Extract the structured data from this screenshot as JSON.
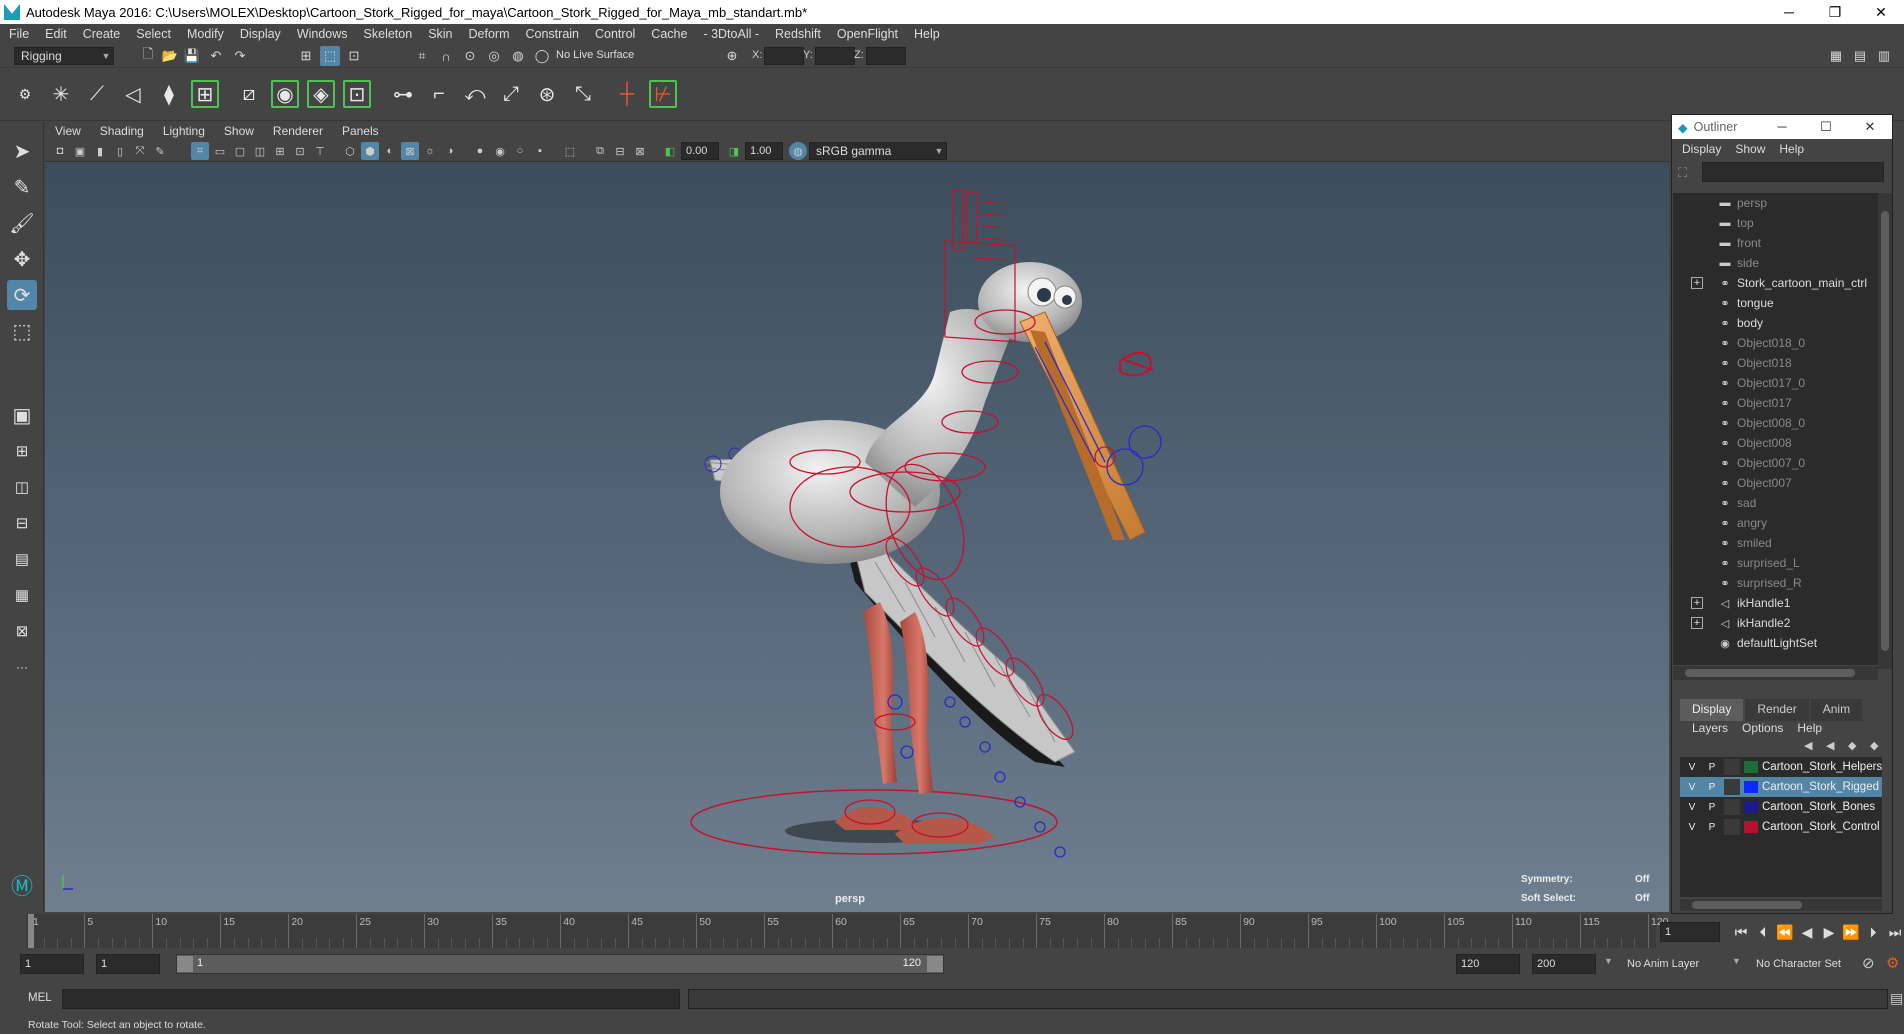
{
  "title_bar": {
    "title": "Autodesk Maya 2016: C:\\Users\\MOLEX\\Desktop\\Cartoon_Stork_Rigged_for_maya\\Cartoon_Stork_Rigged_for_Maya_mb_standart.mb*",
    "min": "─",
    "max": "❐",
    "close": "✕"
  },
  "menu": [
    "File",
    "Edit",
    "Create",
    "Select",
    "Modify",
    "Display",
    "Windows",
    "Skeleton",
    "Skin",
    "Deform",
    "Constrain",
    "Control",
    "Cache",
    "- 3DtoAll -",
    "Redshift",
    "OpenFlight",
    "Help"
  ],
  "status_line": {
    "menu_set": "Rigging",
    "live_surface": "No Live Surface",
    "x_label": "X:",
    "y_label": "Y:",
    "z_label": "Z:"
  },
  "viewport": {
    "menu": [
      "View",
      "Shading",
      "Lighting",
      "Show",
      "Renderer",
      "Panels"
    ],
    "near_value": "0.00",
    "far_value": "1.00",
    "color_space": "sRGB gamma",
    "camera_label": "persp",
    "hud": {
      "symmetry_label": "Symmetry:",
      "symmetry_value": "Off",
      "soft_select_label": "Soft Select:",
      "soft_select_value": "Off"
    },
    "colors": {
      "mesh": "#c9c9c9",
      "controls": "#c8102e",
      "joints": "#2a2ac8",
      "beak": "#e09040",
      "legs": "#c86a5a"
    }
  },
  "outliner": {
    "title": "Outliner",
    "menu": [
      "Display",
      "Show",
      "Help"
    ],
    "items": [
      {
        "label": "persp",
        "icon": "camera",
        "dim": true,
        "expandable": false
      },
      {
        "label": "top",
        "icon": "camera",
        "dim": true,
        "expandable": false
      },
      {
        "label": "front",
        "icon": "camera",
        "dim": true,
        "expandable": false
      },
      {
        "label": "side",
        "icon": "camera",
        "dim": true,
        "expandable": false
      },
      {
        "label": "Stork_cartoon_main_ctrl",
        "icon": "transform",
        "dim": false,
        "expandable": true
      },
      {
        "label": "tongue",
        "icon": "transform",
        "dim": false,
        "expandable": false
      },
      {
        "label": "body",
        "icon": "transform",
        "dim": false,
        "expandable": false
      },
      {
        "label": "Object018_0",
        "icon": "transform",
        "dim": true,
        "expandable": false
      },
      {
        "label": "Object018",
        "icon": "transform",
        "dim": true,
        "expandable": false
      },
      {
        "label": "Object017_0",
        "icon": "transform",
        "dim": true,
        "expandable": false
      },
      {
        "label": "Object017",
        "icon": "transform",
        "dim": true,
        "expandable": false
      },
      {
        "label": "Object008_0",
        "icon": "transform",
        "dim": true,
        "expandable": false
      },
      {
        "label": "Object008",
        "icon": "transform",
        "dim": true,
        "expandable": false
      },
      {
        "label": "Object007_0",
        "icon": "transform",
        "dim": true,
        "expandable": false
      },
      {
        "label": "Object007",
        "icon": "transform",
        "dim": true,
        "expandable": false
      },
      {
        "label": "sad",
        "icon": "transform",
        "dim": true,
        "expandable": false
      },
      {
        "label": "angry",
        "icon": "transform",
        "dim": true,
        "expandable": false
      },
      {
        "label": "smiled",
        "icon": "transform",
        "dim": true,
        "expandable": false
      },
      {
        "label": "surprised_L",
        "icon": "transform",
        "dim": true,
        "expandable": false
      },
      {
        "label": "surprised_R",
        "icon": "transform",
        "dim": true,
        "expandable": false
      },
      {
        "label": "ikHandle1",
        "icon": "ik-handle",
        "dim": false,
        "expandable": true
      },
      {
        "label": "ikHandle2",
        "icon": "ik-handle",
        "dim": false,
        "expandable": true
      },
      {
        "label": "defaultLightSet",
        "icon": "set",
        "dim": false,
        "expandable": false
      }
    ]
  },
  "layer_editor": {
    "tabs": [
      "Display",
      "Render",
      "Anim"
    ],
    "active_tab": "Display",
    "menu": [
      "Layers",
      "Options",
      "Help"
    ],
    "layers": [
      {
        "v": "V",
        "p": "P",
        "name": "Cartoon_Stork_Helpers",
        "color": "#1f6b3a",
        "selected": false
      },
      {
        "v": "V",
        "p": "P",
        "name": "Cartoon_Stork_Rigged",
        "color": "#0a2bff",
        "selected": true
      },
      {
        "v": "V",
        "p": "P",
        "name": "Cartoon_Stork_Bones",
        "color": "#1a1a8a",
        "selected": false
      },
      {
        "v": "V",
        "p": "P",
        "name": "Cartoon_Stork_Control",
        "color": "#b5102e",
        "selected": false
      }
    ]
  },
  "time_slider": {
    "ticks": [
      "1",
      "5",
      "10",
      "15",
      "20",
      "25",
      "30",
      "35",
      "40",
      "45",
      "50",
      "55",
      "60",
      "65",
      "70",
      "75",
      "80",
      "85",
      "90",
      "95",
      "100",
      "105",
      "110",
      "115",
      "120"
    ],
    "current_frame": "1"
  },
  "range_slider": {
    "start": "1",
    "playback_start": "1",
    "range_start_label": "1",
    "range_end_label": "120",
    "playback_end": "120",
    "end": "200",
    "anim_layer": "No Anim Layer",
    "character_set": "No Character Set"
  },
  "command_line": {
    "lang": "MEL"
  },
  "help_line": {
    "text": "Rotate Tool: Select an object to rotate."
  }
}
